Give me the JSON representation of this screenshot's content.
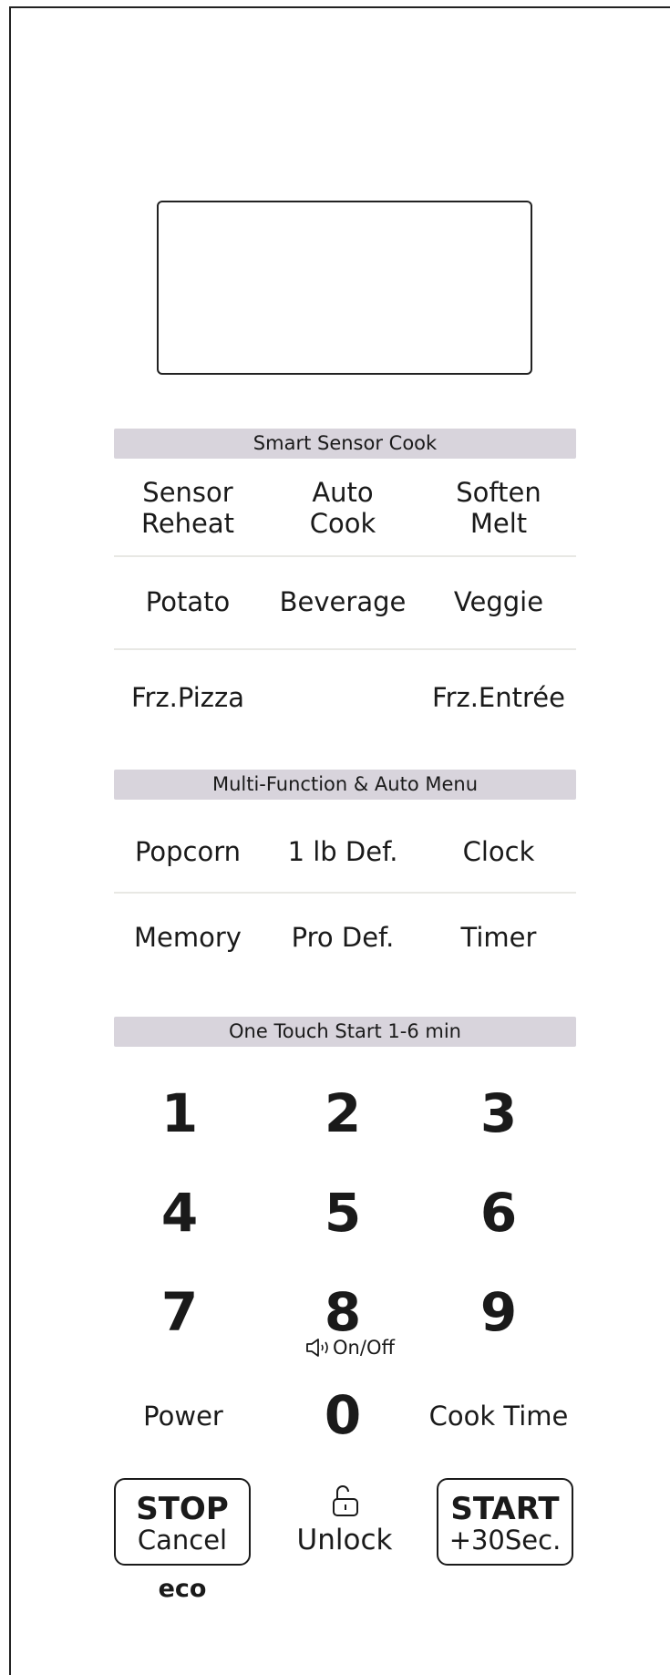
{
  "bands": {
    "smart_sensor": "Smart Sensor Cook",
    "multi_function": "Multi-Function & Auto Menu",
    "one_touch": "One Touch Start 1-6 min"
  },
  "sensor": {
    "sensor_reheat": [
      "Sensor",
      "Reheat"
    ],
    "auto_cook": [
      "Auto",
      "Cook"
    ],
    "soften_melt": [
      "Soften",
      "Melt"
    ],
    "potato": "Potato",
    "beverage": "Beverage",
    "veggie": "Veggie",
    "frz_pizza": "Frz.Pizza",
    "frz_entree": "Frz.Entrée"
  },
  "multi": {
    "popcorn": "Popcorn",
    "one_lb_def": "1 lb Def.",
    "clock": "Clock",
    "memory": "Memory",
    "pro_def": "Pro Def.",
    "timer": "Timer"
  },
  "keypad": {
    "k1": "1",
    "k2": "2",
    "k3": "3",
    "k4": "4",
    "k5": "5",
    "k6": "6",
    "k7": "7",
    "k8": "8",
    "k9": "9",
    "k0": "0",
    "sound_label": "On/Off",
    "power": "Power",
    "cook_time": "Cook Time"
  },
  "controls": {
    "stop_top": "STOP",
    "stop_bottom": "Cancel",
    "eco": "eco",
    "unlock": "Unlock",
    "start_top": "START",
    "start_bottom": "+30Sec."
  },
  "icons": {
    "speaker": "speaker-icon",
    "unlock": "padlock-open-icon"
  }
}
